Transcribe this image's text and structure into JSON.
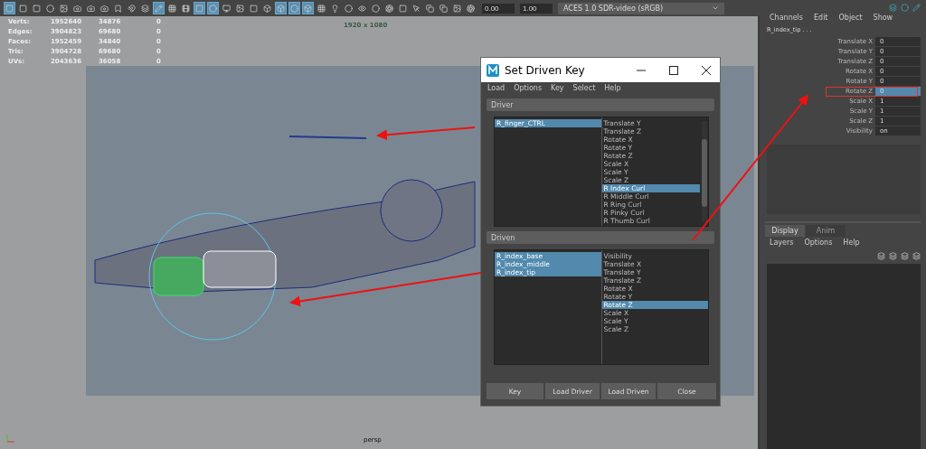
{
  "toolbar": {
    "buttons": [
      {
        "active": true
      },
      {
        "active": false
      },
      {
        "active": false
      },
      {
        "active": false
      },
      {
        "active": false
      },
      {
        "active": false
      },
      {
        "active": false
      },
      {
        "active": false
      },
      {
        "active": false
      },
      {
        "active": false
      },
      {
        "active": false
      },
      {
        "active": true
      },
      {
        "active": false
      },
      {
        "active": false
      },
      {
        "active": true
      },
      {
        "active": true
      },
      {
        "active": false
      },
      {
        "active": false
      },
      {
        "active": false
      },
      {
        "active": false
      },
      {
        "active": true
      },
      {
        "active": true
      },
      {
        "active": true
      },
      {
        "active": false
      },
      {
        "active": false
      },
      {
        "active": false
      },
      {
        "active": false
      },
      {
        "active": false
      },
      {
        "active": false
      },
      {
        "active": false
      },
      {
        "active": false
      },
      {
        "active": false
      },
      {
        "active": false
      },
      {
        "active": false
      },
      {
        "active": false
      }
    ],
    "exposure": "0.00",
    "gamma": "1.00",
    "color_space": "ACES 1.0 SDR-video (sRGB)"
  },
  "hud": {
    "stats": [
      {
        "label": "Verts:",
        "values": [
          "1952640",
          "34876",
          "0"
        ]
      },
      {
        "label": "Edges:",
        "values": [
          "3904823",
          "69680",
          "0"
        ]
      },
      {
        "label": "Faces:",
        "values": [
          "1952459",
          "34840",
          "0"
        ]
      },
      {
        "label": "Tris:",
        "values": [
          "3904728",
          "69680",
          "0"
        ]
      },
      {
        "label": "UVs:",
        "values": [
          "2043636",
          "36058",
          "0"
        ]
      }
    ],
    "resolution": "1920 x 1080",
    "camera": "persp"
  },
  "dialog": {
    "title": "Set Driven Key",
    "menu": [
      "Load",
      "Options",
      "Key",
      "Select",
      "Help"
    ],
    "sections": [
      {
        "label": "Driver",
        "objects": [
          {
            "name": "R_finger_CTRL",
            "selected": true
          }
        ],
        "attributes": [
          {
            "name": "Translate Y",
            "selected": false
          },
          {
            "name": "Translate Z",
            "selected": false
          },
          {
            "name": "Rotate X",
            "selected": false
          },
          {
            "name": "Rotate Y",
            "selected": false
          },
          {
            "name": "Rotate Z",
            "selected": false
          },
          {
            "name": "Scale X",
            "selected": false
          },
          {
            "name": "Scale Y",
            "selected": false
          },
          {
            "name": "Scale Z",
            "selected": false
          },
          {
            "name": "R Index Curl",
            "selected": true
          },
          {
            "name": "R Middle Curl",
            "selected": false
          },
          {
            "name": "R Ring Curl",
            "selected": false
          },
          {
            "name": "R Pinky Curl",
            "selected": false
          },
          {
            "name": "R Thumb Curl",
            "selected": false
          }
        ],
        "scrollbar": true
      },
      {
        "label": "Driven",
        "objects": [
          {
            "name": "R_index_base",
            "selected": true
          },
          {
            "name": "R_index_middle",
            "selected": true
          },
          {
            "name": "R_index_tip",
            "selected": true
          }
        ],
        "attributes": [
          {
            "name": "Visibility",
            "selected": false
          },
          {
            "name": "Translate X",
            "selected": false
          },
          {
            "name": "Translate Y",
            "selected": false
          },
          {
            "name": "Translate Z",
            "selected": false
          },
          {
            "name": "Rotate X",
            "selected": false
          },
          {
            "name": "Rotate Y",
            "selected": false
          },
          {
            "name": "Rotate Z",
            "selected": true
          },
          {
            "name": "Scale X",
            "selected": false
          },
          {
            "name": "Scale Y",
            "selected": false
          },
          {
            "name": "Scale Z",
            "selected": false
          }
        ],
        "scrollbar": false
      }
    ],
    "buttons": [
      "Key",
      "Load Driver",
      "Load Driven",
      "Close"
    ]
  },
  "channel_box": {
    "menu": [
      "Channels",
      "Edit",
      "Object",
      "Show"
    ],
    "object": "R_index_tip . . .",
    "channels": [
      {
        "name": "Translate X",
        "value": "0",
        "selected": false
      },
      {
        "name": "Translate Y",
        "value": "0",
        "selected": false
      },
      {
        "name": "Translate Z",
        "value": "0",
        "selected": false
      },
      {
        "name": "Rotate X",
        "value": "0",
        "selected": false
      },
      {
        "name": "Rotate Y",
        "value": "0",
        "selected": false
      },
      {
        "name": "Rotate Z",
        "value": "0",
        "selected": true
      },
      {
        "name": "Scale X",
        "value": "1",
        "selected": false
      },
      {
        "name": "Scale Y",
        "value": "1",
        "selected": false
      },
      {
        "name": "Scale Z",
        "value": "1",
        "selected": false
      },
      {
        "name": "Visibility",
        "value": "on",
        "selected": false
      }
    ]
  },
  "layer_editor": {
    "tabs": [
      {
        "label": "Display",
        "selected": true
      },
      {
        "label": "Anim",
        "selected": false
      }
    ],
    "menu": [
      "Layers",
      "Options",
      "Help"
    ]
  }
}
